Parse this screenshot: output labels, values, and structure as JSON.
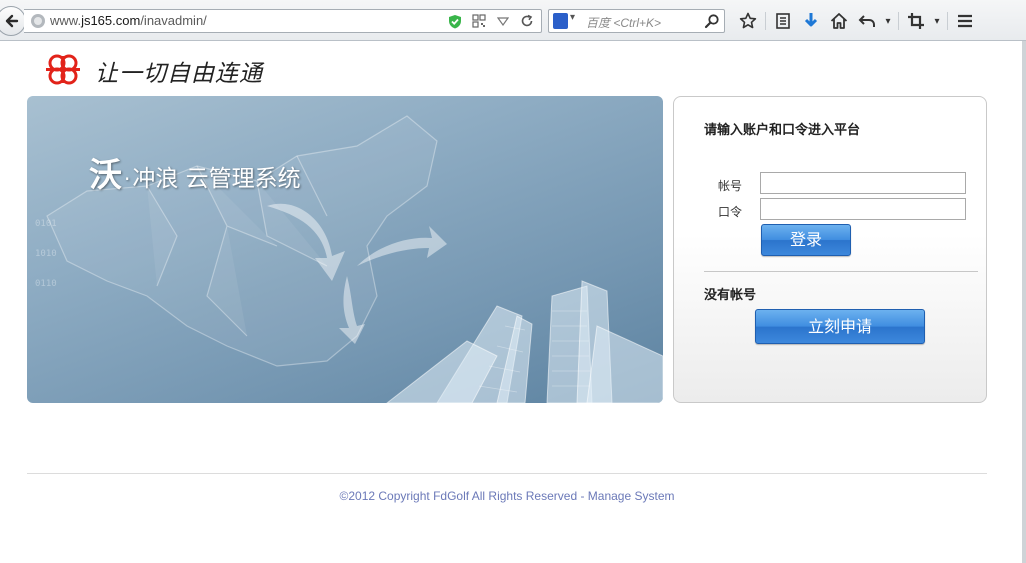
{
  "browser": {
    "url_prefix": "www.",
    "url_host": "js165.com",
    "url_path": "/inavadmin/",
    "search_placeholder": "百度 <Ctrl+K>"
  },
  "logo": {
    "slogan": "让一切自由连通"
  },
  "banner": {
    "title_big": "沃",
    "title_dot": "·",
    "title_rest": "冲浪 云管理系统"
  },
  "login": {
    "heading": "请输入账户和口令进入平台",
    "account_label": "帐号",
    "password_label": "口令",
    "account_value": "",
    "password_value": "",
    "login_button": "登录",
    "no_account": "没有帐号",
    "signup_button": "立刻申请"
  },
  "footer": {
    "copyright": "©2012 Copyright FdGolf All Rights Reserved - Manage System"
  },
  "colors": {
    "brand_red": "#e2231a",
    "button_blue": "#3f8de0",
    "footer_text": "#6b79b8"
  }
}
